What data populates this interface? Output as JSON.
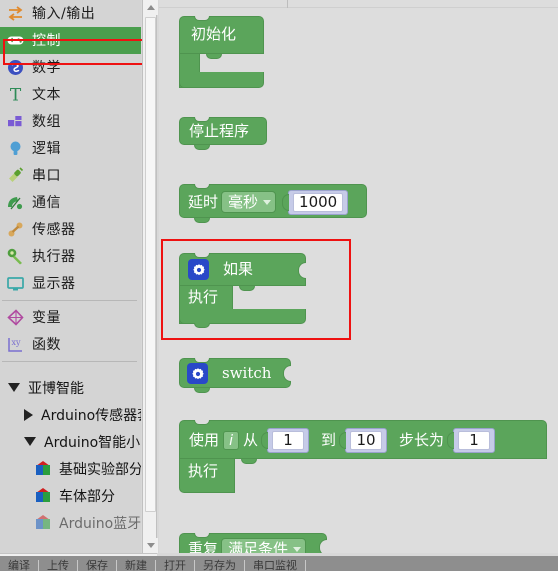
{
  "sidebar": {
    "categories": [
      {
        "label": "输入/输出",
        "icon": "io-arrows-icon",
        "selected": false
      },
      {
        "label": "控制",
        "icon": "gamepad-icon",
        "selected": true
      },
      {
        "label": "数学",
        "icon": "math-circle-icon",
        "selected": false
      },
      {
        "label": "文本",
        "icon": "text-t-icon",
        "selected": false
      },
      {
        "label": "数组",
        "icon": "array-blocks-icon",
        "selected": false
      },
      {
        "label": "逻辑",
        "icon": "lightbulb-icon",
        "selected": false
      },
      {
        "label": "串口",
        "icon": "serial-plug-icon",
        "selected": false
      },
      {
        "label": "通信",
        "icon": "antenna-icon",
        "selected": false
      },
      {
        "label": "传感器",
        "icon": "sensor-icon",
        "selected": false
      },
      {
        "label": "执行器",
        "icon": "actuator-icon",
        "selected": false
      },
      {
        "label": "显示器",
        "icon": "monitor-icon",
        "selected": false
      }
    ],
    "categories2": [
      {
        "label": "变量",
        "icon": "variable-icon",
        "selected": false
      },
      {
        "label": "函数",
        "icon": "function-xy-icon",
        "selected": false
      }
    ],
    "tree": [
      {
        "label": "亚博智能",
        "indent": 0,
        "arrow": "down",
        "icon": "none"
      },
      {
        "label": "Arduino传感器套件",
        "indent": 1,
        "arrow": "right",
        "icon": "none"
      },
      {
        "label": "Arduino智能小车",
        "indent": 1,
        "arrow": "down",
        "icon": "none"
      },
      {
        "label": "基础实验部分",
        "indent": 2,
        "arrow": "none",
        "icon": "cube"
      },
      {
        "label": "车体部分",
        "indent": 2,
        "arrow": "none",
        "icon": "cube"
      },
      {
        "label": "Arduino蓝牙...",
        "indent": 2,
        "arrow": "none",
        "icon": "cube"
      }
    ],
    "highlight_color": "#ee1111",
    "selected_bg": "#4a9e4d"
  },
  "canvas": {
    "block_color": "#5ba55b",
    "blocks": {
      "init": {
        "label": "初始化"
      },
      "stop": {
        "label": "停止程序"
      },
      "delay": {
        "label": "延时",
        "unit": "毫秒",
        "value": "1000"
      },
      "if": {
        "label": "如果",
        "do_label": "执行",
        "gear_icon": "gear-icon"
      },
      "switch": {
        "label": "switch",
        "gear_icon": "gear-icon"
      },
      "for": {
        "use_label": "使用",
        "var": "i",
        "from_label": "从",
        "from_value": "1",
        "to_label": "到",
        "to_value": "10",
        "step_label": "步长为",
        "step_value": "1",
        "do_label": "执行"
      },
      "repeat": {
        "label": "重复",
        "mode": "满足条件"
      }
    }
  },
  "bottombar": {
    "tabs": [
      "编译",
      "上传",
      "保存",
      "新建",
      "打开",
      "另存为",
      "串口监视"
    ]
  }
}
